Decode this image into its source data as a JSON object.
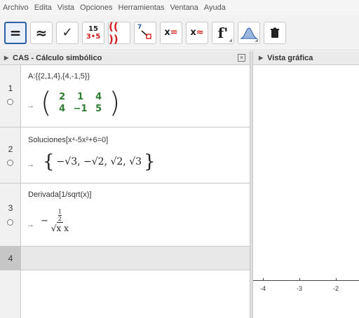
{
  "menu": [
    "Archivo",
    "Edita",
    "Vista",
    "Opciones",
    "Herramientas",
    "Ventana",
    "Ayuda"
  ],
  "toolbar": {
    "buttons": [
      {
        "name": "evaluate-tool",
        "label": "="
      },
      {
        "name": "numeric-tool",
        "label": "≈"
      },
      {
        "name": "keep-input-tool",
        "label": "✓"
      },
      {
        "name": "factor-tool",
        "top": "15",
        "bottom": "3•5"
      },
      {
        "name": "expand-tool",
        "label": "(( ))"
      },
      {
        "name": "substitute-tool",
        "label": "7"
      },
      {
        "name": "solve-tool",
        "label": "x="
      },
      {
        "name": "nsolve-tool",
        "label": "x≈"
      },
      {
        "name": "derivative-tool",
        "label": "f'"
      },
      {
        "name": "probability-tool",
        "label": ""
      },
      {
        "name": "delete-tool",
        "label": ""
      }
    ]
  },
  "cas": {
    "title": "CAS - Cálculo simbólico",
    "close": "×",
    "rows": [
      {
        "num": "1",
        "input": "A:{{2,1,4},{4,-1,5}}",
        "arrow": "→",
        "matrix": [
          [
            "2",
            "1",
            "4"
          ],
          [
            "4",
            "−1",
            "5"
          ]
        ]
      },
      {
        "num": "2",
        "input": "Soluciones[x⁴-5x²+6=0]",
        "arrow": "→",
        "solutions": "−√3, −√2, √2, √3"
      },
      {
        "num": "3",
        "input": "Derivada[1/sqrt(x)]",
        "arrow": "→",
        "derivative": {
          "sign": "−",
          "num_top": "1",
          "num_bottom": "2",
          "den": "√x x"
        }
      },
      {
        "num": "4"
      }
    ]
  },
  "graphics": {
    "title": "Vista gráfica",
    "ticks": [
      "-4",
      "-3",
      "-2"
    ]
  }
}
